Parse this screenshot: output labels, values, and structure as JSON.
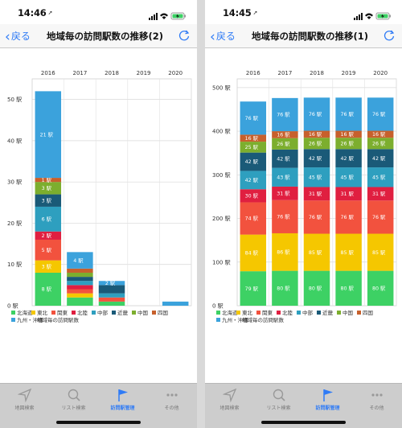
{
  "colors": {
    "accent": "#2f7bf6",
    "regions": [
      "#3dd164",
      "#f5c700",
      "#f2523e",
      "#e01f40",
      "#2e9fbf",
      "#1a5a78",
      "#7cae2e",
      "#c7602c",
      "#3ba2dc"
    ]
  },
  "regions": [
    "北海道",
    "東北",
    "関東",
    "北陸",
    "中部",
    "近畿",
    "中国",
    "四国",
    "九州・沖縄"
  ],
  "legend_total": "地域毎の訪問駅数",
  "unit": "駅",
  "tabs": [
    {
      "label": "地図検索",
      "icon": "location-arrow-icon"
    },
    {
      "label": "リスト検索",
      "icon": "magnifier-icon"
    },
    {
      "label": "訪問駅管理",
      "icon": "flag-icon"
    },
    {
      "label": "その他",
      "icon": "more-dots-icon"
    }
  ],
  "screens": [
    {
      "time": "14:46",
      "back_label": "戻る",
      "title": "地域毎の訪問駅数の推移(2)",
      "active_tab": 2,
      "chart_data": {
        "type": "bar",
        "stacked": true,
        "categories": [
          "2016",
          "2017",
          "2018",
          "2019",
          "2020"
        ],
        "ylim": [
          0,
          55
        ],
        "yticks": [
          0,
          10,
          20,
          30,
          40,
          50
        ],
        "series": [
          {
            "name": "北海道",
            "values": [
              8,
              2,
              1,
              0,
              0
            ]
          },
          {
            "name": "東北",
            "values": [
              3,
              1,
              0,
              0,
              0
            ]
          },
          {
            "name": "関東",
            "values": [
              5,
              1,
              1,
              0,
              0
            ]
          },
          {
            "name": "北陸",
            "values": [
              2,
              1,
              0,
              0,
              0
            ]
          },
          {
            "name": "中部",
            "values": [
              6,
              1,
              1,
              0,
              0
            ]
          },
          {
            "name": "近畿",
            "values": [
              3,
              1,
              2,
              0,
              0
            ]
          },
          {
            "name": "中国",
            "values": [
              3,
              1,
              0,
              0,
              0
            ]
          },
          {
            "name": "四国",
            "values": [
              1,
              1,
              0,
              0,
              0
            ]
          },
          {
            "name": "九州・沖縄",
            "values": [
              21,
              4,
              1,
              0,
              1
            ]
          }
        ],
        "segment_labels": [
          [
            "8 駅",
            "3 駅",
            "5 駅",
            "2 駅",
            "6 駅",
            "3 駅",
            "3 駅",
            "1 駅",
            "21 駅"
          ],
          [
            "",
            "",
            "",
            "",
            "",
            "",
            "",
            "",
            "4 駅"
          ],
          [
            "",
            "",
            "",
            "",
            "",
            "",
            "",
            "",
            "2 駅"
          ],
          [
            "",
            "",
            "",
            "",
            "",
            "",
            "",
            "",
            ""
          ],
          [
            "",
            "",
            "",
            "",
            "",
            "",
            "",
            "",
            ""
          ]
        ]
      }
    },
    {
      "time": "14:45",
      "back_label": "戻る",
      "title": "地域毎の訪問駅数の推移(1)",
      "active_tab": 2,
      "chart_data": {
        "type": "bar",
        "stacked": true,
        "categories": [
          "2016",
          "2017",
          "2018",
          "2019",
          "2020"
        ],
        "ylim": [
          0,
          520
        ],
        "yticks": [
          0,
          100,
          200,
          300,
          400,
          500
        ],
        "series": [
          {
            "name": "北海道",
            "values": [
              79,
              80,
              80,
              80,
              80
            ]
          },
          {
            "name": "東北",
            "values": [
              84,
              86,
              85,
              85,
              85
            ]
          },
          {
            "name": "関東",
            "values": [
              74,
              76,
              76,
              76,
              76
            ]
          },
          {
            "name": "北陸",
            "values": [
              30,
              31,
              31,
              31,
              31
            ]
          },
          {
            "name": "中部",
            "values": [
              42,
              43,
              45,
              45,
              45
            ]
          },
          {
            "name": "近畿",
            "values": [
              42,
              42,
              42,
              42,
              42
            ]
          },
          {
            "name": "中国",
            "values": [
              25,
              26,
              26,
              26,
              26
            ]
          },
          {
            "name": "四国",
            "values": [
              16,
              16,
              16,
              16,
              16
            ]
          },
          {
            "name": "九州・沖縄",
            "values": [
              76,
              76,
              76,
              76,
              76
            ]
          }
        ],
        "segment_labels": [
          [
            "79 駅",
            "84 駅",
            "74 駅",
            "30 駅",
            "42 駅",
            "42 駅",
            "25 駅",
            "16 駅",
            "76 駅"
          ],
          [
            "80 駅",
            "86 駅",
            "76 駅",
            "31 駅",
            "43 駅",
            "42 駅",
            "26 駅",
            "16 駅",
            "76 駅"
          ],
          [
            "80 駅",
            "85 駅",
            "76 駅",
            "31 駅",
            "45 駅",
            "42 駅",
            "26 駅",
            "16 駅",
            "76 駅"
          ],
          [
            "80 駅",
            "85 駅",
            "76 駅",
            "31 駅",
            "45 駅",
            "42 駅",
            "26 駅",
            "16 駅",
            "76 駅"
          ],
          [
            "80 駅",
            "85 駅",
            "76 駅",
            "31 駅",
            "45 駅",
            "42 駅",
            "26 駅",
            "16 駅",
            "76 駅"
          ]
        ]
      }
    }
  ]
}
